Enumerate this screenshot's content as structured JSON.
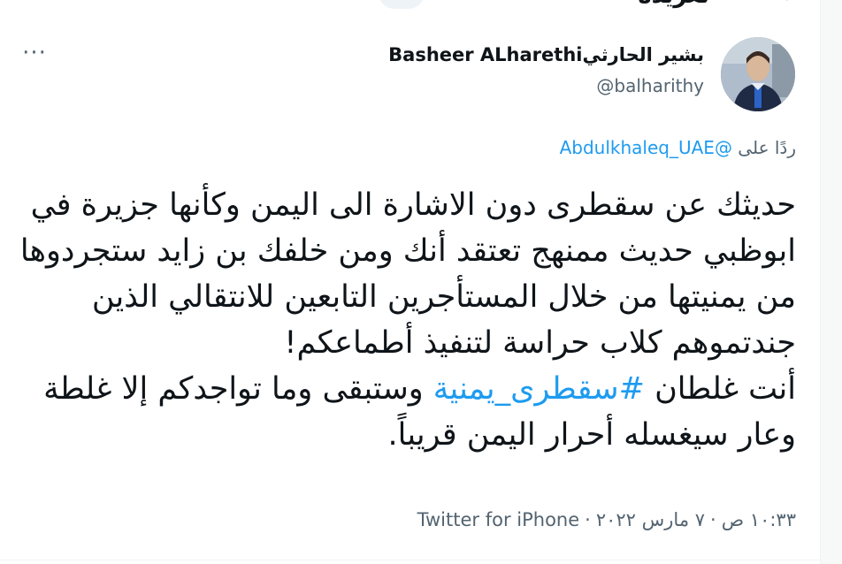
{
  "header": {
    "partial_text": "تغريدة",
    "back_glyph": "‹"
  },
  "author": {
    "display_name": "Basheer ALharethiبشير الحارثي",
    "handle": "@balharithy"
  },
  "menu_glyph": "···",
  "reply": {
    "prefix": "ردًا على",
    "mention": "@Abdulkhaleq_UAE"
  },
  "tweet": {
    "text_part1": "حديثك عن سقطرى دون الاشارة الى اليمن وكأنها جزيرة في ابوظبي حديث ممنهج تعتقد أنك ومن خلفك بن زايد ستجردوها من يمنيتها من خلال المستأجرين التابعين للانتقالي الذين جندتموهم كلاب حراسة لتنفيذ أطماعكم!\nأنت غلطان ",
    "hashtag": "#سقطرى_يمنية",
    "text_part2": " وستبقى وما تواجدكم إلا غلطة وعار سيغسله أحرار اليمن قريباً."
  },
  "meta": {
    "time": "١٠:٣٣ ص",
    "date": "٧ مارس ٢٠٢٢",
    "separator": "·",
    "source": "Twitter for iPhone"
  },
  "colors": {
    "link": "#1d9bf0",
    "secondary_text": "#536471",
    "primary_text": "#0f1419"
  }
}
